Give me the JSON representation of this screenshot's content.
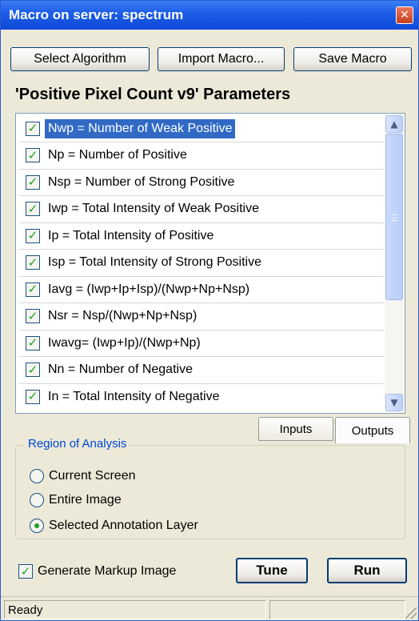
{
  "window": {
    "title": "Macro on server: spectrum",
    "close_glyph": "✕"
  },
  "toolbar": {
    "select_algorithm": "Select Algorithm",
    "import_macro": "Import Macro...",
    "save_macro": "Save Macro"
  },
  "parameters": {
    "heading": "'Positive Pixel Count v9'  Parameters",
    "items": [
      {
        "label": "Nwp = Number of Weak Positive",
        "checked": true,
        "selected": true
      },
      {
        "label": "Np  = Number of Positive",
        "checked": true,
        "selected": false
      },
      {
        "label": "Nsp = Number of Strong Positive",
        "checked": true,
        "selected": false
      },
      {
        "label": "Iwp = Total Intensity of Weak Positive",
        "checked": true,
        "selected": false
      },
      {
        "label": "Ip  = Total Intensity of Positive",
        "checked": true,
        "selected": false
      },
      {
        "label": "Isp = Total Intensity of Strong Positive",
        "checked": true,
        "selected": false
      },
      {
        "label": "Iavg = (Iwp+Ip+Isp)/(Nwp+Np+Nsp)",
        "checked": true,
        "selected": false
      },
      {
        "label": "Nsr  = Nsp/(Nwp+Np+Nsp)",
        "checked": true,
        "selected": false
      },
      {
        "label": "Iwavg= (Iwp+Ip)/(Nwp+Np)",
        "checked": true,
        "selected": false
      },
      {
        "label": "Nn = Number of Negative",
        "checked": true,
        "selected": false
      },
      {
        "label": "In = Total Intensity of Negative",
        "checked": true,
        "selected": false
      }
    ],
    "scroll_up_icon": "▲",
    "scroll_down_icon": "▼"
  },
  "tabs": {
    "inputs": "Inputs",
    "outputs": "Outputs",
    "active": "outputs"
  },
  "region": {
    "label": "Region of Analysis",
    "options": [
      "Current Screen",
      "Entire Image",
      "Selected Annotation Layer"
    ],
    "selected_index": 2
  },
  "markup": {
    "label": "Generate Markup Image",
    "checked": true
  },
  "actions": {
    "tune": "Tune",
    "run": "Run"
  },
  "status": {
    "text": "Ready"
  },
  "colors": {
    "accent": "#316ac5",
    "check": "#21a121",
    "group_label": "#0046d5"
  }
}
